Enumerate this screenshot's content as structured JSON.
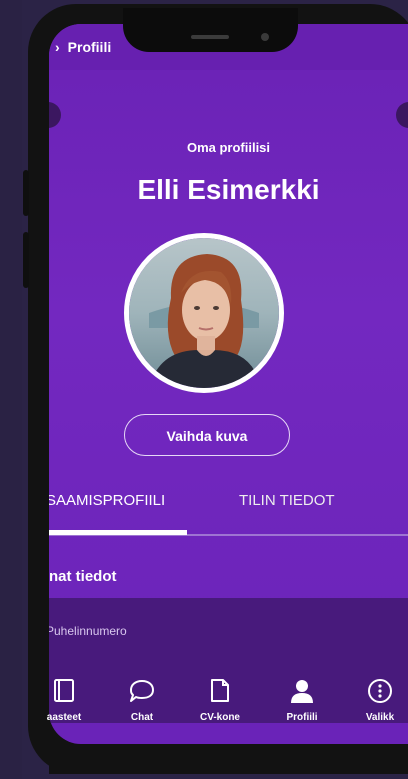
{
  "header": {
    "back_label": "Profiili"
  },
  "profile": {
    "subtitle": "Oma profiilisi",
    "name": "Elli Esimerkki",
    "change_photo_label": "Vaihda kuva"
  },
  "tabs": [
    {
      "label": "SAAMISPROFIILI",
      "active": true
    },
    {
      "label": "TILIN TIEDOT",
      "active": false
    }
  ],
  "section": {
    "title": "nat tiedot",
    "field_label": "Puhelinnumero"
  },
  "bottom_nav": [
    {
      "label": "aasteet",
      "icon": "book-icon"
    },
    {
      "label": "Chat",
      "icon": "chat-icon"
    },
    {
      "label": "CV-kone",
      "icon": "document-icon"
    },
    {
      "label": "Profiili",
      "icon": "person-icon"
    },
    {
      "label": "Valikk",
      "icon": "more-icon"
    }
  ],
  "colors": {
    "primary": "#6a22b5",
    "dark_panel": "#481a7c"
  }
}
